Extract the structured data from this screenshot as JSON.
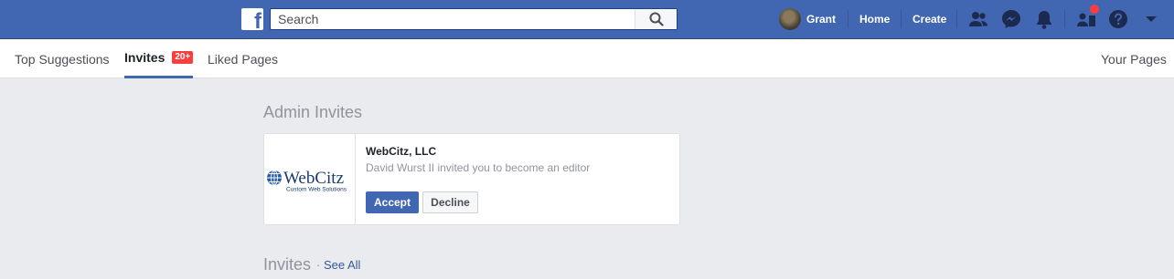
{
  "topbar": {
    "logo_letter": "f",
    "search": {
      "placeholder": "Search"
    },
    "profile_name": "Grant",
    "home_label": "Home",
    "create_label": "Create",
    "icons": [
      "friends-icon",
      "messenger-icon",
      "notifications-icon",
      "pages-icon",
      "help-icon",
      "dropdown-icon"
    ]
  },
  "subnav": {
    "tabs": [
      {
        "label": "Top Suggestions"
      },
      {
        "label": "Invites",
        "badge": "20+"
      },
      {
        "label": "Liked Pages"
      }
    ],
    "right_link": "Your Pages"
  },
  "admin_invites": {
    "title": "Admin Invites",
    "card": {
      "logo_text": "WebCitz",
      "logo_tagline": "Custom Web Solutions",
      "name": "WebCitz, LLC",
      "description": "David Wurst II invited you to become an editor",
      "accept_label": "Accept",
      "decline_label": "Decline"
    }
  },
  "invites": {
    "title": "Invites",
    "separator": "·",
    "see_all": "See All"
  },
  "colors": {
    "brand": "#4267b2",
    "badge": "#fa3e3e",
    "background": "#e9ebee"
  }
}
